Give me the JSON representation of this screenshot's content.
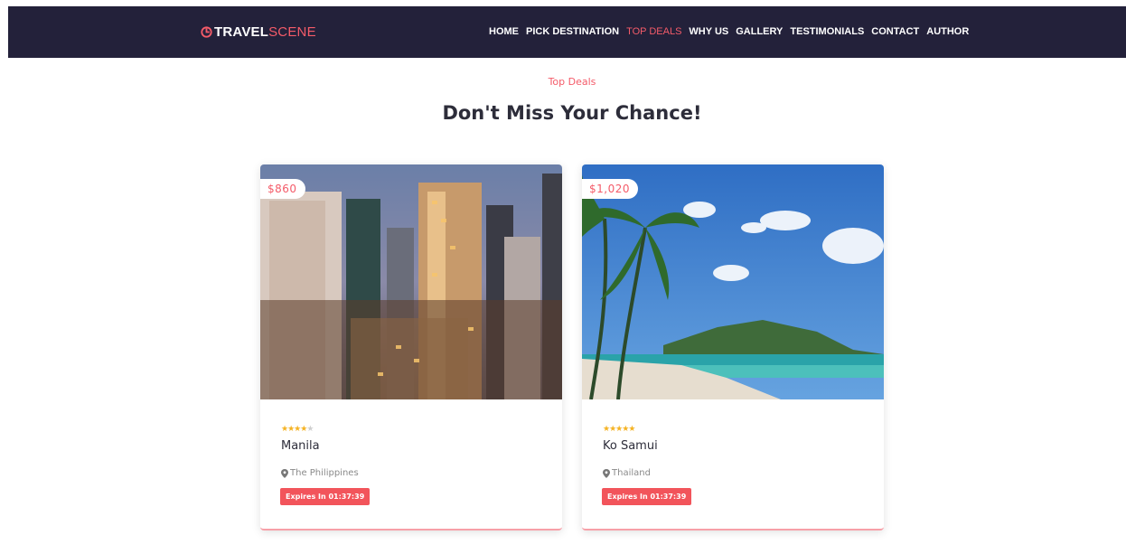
{
  "header": {
    "logo": {
      "prefix": "TRAVEL",
      "accent": "SCENE",
      "icon": "target-icon"
    },
    "nav": [
      {
        "label": "HOME",
        "active": false
      },
      {
        "label": "PICK DESTINATION",
        "active": false
      },
      {
        "label": "TOP DEALS",
        "active": true
      },
      {
        "label": "WHY US",
        "active": false
      },
      {
        "label": "GALLERY",
        "active": false
      },
      {
        "label": "TESTIMONIALS",
        "active": false
      },
      {
        "label": "CONTACT",
        "active": false
      },
      {
        "label": "AUTHOR",
        "active": false
      }
    ]
  },
  "section": {
    "eyebrow": "Top Deals",
    "title": "Don't Miss Your Chance!"
  },
  "deals": [
    {
      "price": "$860",
      "rating": 4,
      "max_rating": 5,
      "city": "Manila",
      "country": "The Philippines",
      "expires": "Expires In 01:37:39"
    },
    {
      "price": "$1,020",
      "rating": 5,
      "max_rating": 5,
      "city": "Ko Samui",
      "country": "Thailand",
      "expires": "Expires In 01:37:39"
    }
  ],
  "colors": {
    "nav_bg": "#23213a",
    "accent": "#f45b69",
    "star": "#f5b324"
  }
}
